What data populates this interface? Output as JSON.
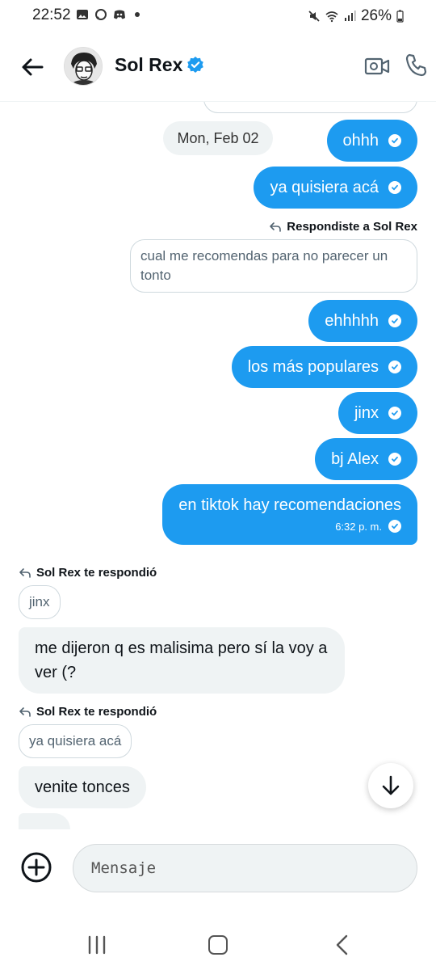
{
  "status_bar": {
    "time": "22:52",
    "battery": "26%",
    "icons": [
      "gallery-icon",
      "chat-icon",
      "discord-icon",
      "dot-icon",
      "mute-icon",
      "wifi-icon",
      "signal-icon",
      "battery-icon"
    ]
  },
  "header": {
    "contact_name": "Sol Rex",
    "verified": true,
    "icons": [
      "back-arrow-icon",
      "verified-badge-icon",
      "video-call-icon",
      "phone-icon"
    ]
  },
  "colors": {
    "accent": "#1d9bf0",
    "incoming_bubble": "#eff3f4",
    "text_primary": "#0f1419",
    "text_secondary": "#536471"
  },
  "messages": {
    "date_separator": "Mon, Feb 02",
    "out_1": "ohhh",
    "out_2": "ya quisiera acá",
    "reply_label_1": "Respondiste a Sol Rex",
    "quote_1": "cual me recomendas para no parecer un tonto",
    "out_3": "ehhhhh",
    "out_4": "los más populares",
    "out_5": "jinx",
    "out_6": "bj Alex",
    "out_7": "en tiktok hay recomendaciones",
    "out_7_time": "6:32 p. m.",
    "reply_label_2": "Sol Rex te respondió",
    "quote_2": "jinx",
    "in_1": "me dijeron q es malisima pero sí la voy a ver (?",
    "reply_label_3": "Sol Rex te respondió",
    "quote_3": "ya quisiera acá",
    "in_2": "venite tonces"
  },
  "composer": {
    "placeholder": "Mensaje"
  }
}
